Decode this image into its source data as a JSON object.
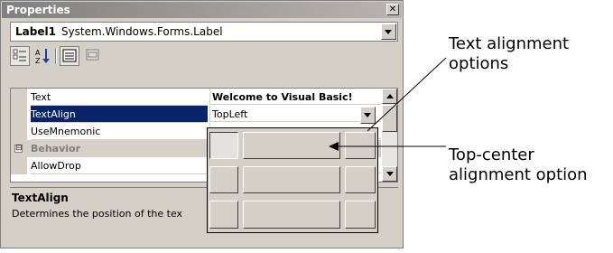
{
  "window": {
    "title": "Properties",
    "close_glyph": "✕"
  },
  "object_selector": {
    "name": "Label1",
    "type": "System.Windows.Forms.Label"
  },
  "toolbar": {
    "buttons": [
      {
        "icon": "categorized-icon",
        "pressed": true
      },
      {
        "icon": "alphabetical-icon",
        "pressed": false
      },
      {
        "icon": "properties-icon",
        "pressed": true
      },
      {
        "icon": "events-icon",
        "pressed": false
      }
    ]
  },
  "grid": {
    "rows": [
      {
        "name": "Text",
        "value": "Welcome to Visual Basic!"
      },
      {
        "name": "TextAlign",
        "value": "TopLeft",
        "selected": true
      },
      {
        "name": "UseMnemonic",
        "value": ""
      },
      {
        "name": "Behavior",
        "value": "",
        "category": true,
        "toggle": "⊟"
      },
      {
        "name": "AllowDrop",
        "value": ""
      }
    ]
  },
  "description": {
    "title": "TextAlign",
    "text": "Determines the position of the tex"
  },
  "align_picker": {
    "selected": "TopLeft",
    "options": [
      "TopLeft",
      "TopCenter",
      "TopRight",
      "MiddleLeft",
      "MiddleCenter",
      "MiddleRight",
      "BottomLeft",
      "BottomCenter",
      "BottomRight"
    ]
  },
  "annotations": {
    "text_alignment_line1": "Text alignment",
    "text_alignment_line2": "options",
    "top_center_line1": "Top-center",
    "top_center_line2": "alignment option"
  }
}
